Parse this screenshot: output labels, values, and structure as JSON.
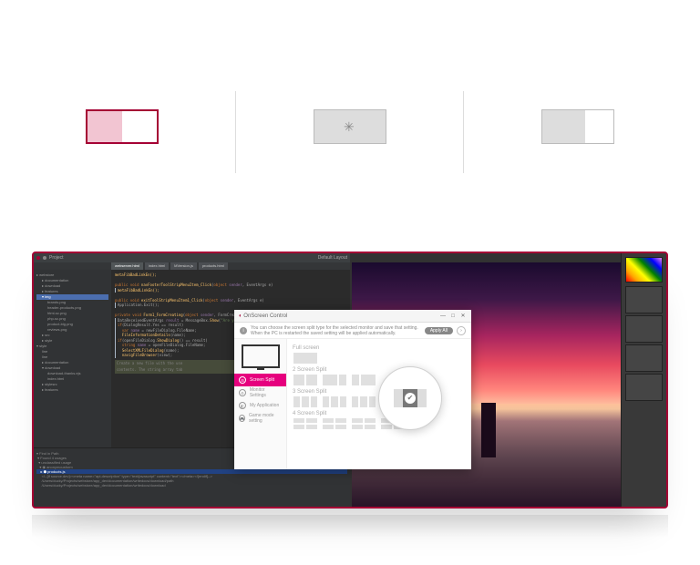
{
  "tabs": {
    "active_label": "split-half",
    "loading_label": "loading",
    "third_label": "split-narrow"
  },
  "ide": {
    "project_label": "Project",
    "tabs": [
      "webserver.html",
      "index.html",
      "MVersion.js",
      "products.html"
    ],
    "default_title": "Default Layout",
    "tree": {
      "root": "webstore",
      "items": [
        "documentation",
        "download",
        "features",
        "img",
        "brands.png",
        "header-products.png",
        "html-sc.png",
        "php-sc.png",
        "product-big.png",
        "reviews.png",
        "src",
        "style",
        "line",
        "line",
        "documentation",
        "download",
        "download-thanks.ejs",
        "index.html",
        "stylesrc",
        "features"
      ]
    },
    "code": {
      "lines": [
        "metaFibBadLinkEn();",
        "public void navFooterToolStripMenuItem_Click(object sender, EventArgs e)",
        "metaFibBadLinkEn();",
        "public void exitToolStripMenuItem1_Click(object sender, EventArgs e)",
        "Application.Exit();",
        "private void Form1_FormCreating(object sender, FormCreatingEventArgs",
        "DataReceivedEventArgs result = MessageBox.Show(\"Are you sure you want",
        "if(DialogResult.Yes == result)",
        "var name = newFileDialog.FileName;",
        "FileInformationDetails(name);",
        "if(openFileDialog.ShowDialog() == result)",
        "string name = openFileDialog.FileName;",
        "SelectXMLFileDialog(name);",
        "navigFileBrowser(view);",
        "Create a new file with the use",
        "contents. The string array tab"
      ]
    },
    "find": {
      "title": "Find in Path",
      "result": "Found 4 usages",
      "scope": "unclassified usage",
      "target": "anonymousform",
      "file": "products.js",
      "paths": [
        "/Users/ducky/Projects/webstore/app_dev/documentation/writedocs/download/path",
        "/Users/ducky/Projects/webstore/app_dev/documentation/writedocs/download"
      ],
      "snippet": "<!--[if source.dev]><meta name=\"api-description\" type=\"text/javascript\" content=\"text\"></meta><![endif]-->"
    }
  },
  "osc": {
    "title": "OnScreen Control",
    "tip_text": "You can choose the screen split type for the selected monitor and save that setting. When the PC is restarted the saved setting will be applied automatically.",
    "apply_label": "Apply All",
    "sidebar": [
      "Screen Split",
      "Monitor Settings",
      "My Application",
      "Game mode setting"
    ],
    "sections": [
      "Full screen",
      "2 Screen Split",
      "3 Screen Split",
      "4 Screen Split"
    ]
  }
}
